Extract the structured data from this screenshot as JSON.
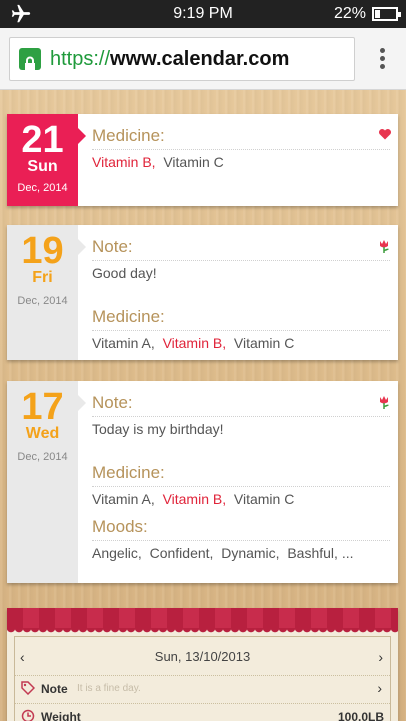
{
  "status": {
    "time": "9:19 PM",
    "battery": "22%",
    "battery_level": 0.22
  },
  "browser": {
    "url_scheme": "https://",
    "url_host": "www.calendar.com"
  },
  "entries": [
    {
      "day": "21",
      "weekday": "Sun",
      "month": "Dec, 2014",
      "sections": [
        {
          "title": "Medicine:",
          "items": [
            "Vitamin B,",
            "Vitamin C"
          ],
          "highlight": [
            true,
            false
          ]
        }
      ],
      "icon": "heart-icon"
    },
    {
      "day": "19",
      "weekday": "Fri",
      "month": "Dec, 2014",
      "sections": [
        {
          "title": "Note:",
          "text": "Good day!"
        },
        {
          "title": "Medicine:",
          "items": [
            "Vitamin A,",
            "Vitamin B,",
            "Vitamin C"
          ],
          "highlight": [
            false,
            true,
            false
          ]
        }
      ],
      "icon": "tulip-icon"
    },
    {
      "day": "17",
      "weekday": "Wed",
      "month": "Dec, 2014",
      "sections": [
        {
          "title": "Note:",
          "text": "Today is my birthday!"
        },
        {
          "title": "Medicine:",
          "items": [
            "Vitamin A,",
            "Vitamin B,",
            "Vitamin C"
          ],
          "highlight": [
            false,
            true,
            false
          ]
        },
        {
          "title": "Moods:",
          "items": [
            "Angelic,",
            "Confident,",
            "Dynamic,",
            "Bashful, ..."
          ],
          "highlight": [
            false,
            false,
            false,
            false
          ]
        }
      ],
      "icon": "tulip-icon"
    }
  ],
  "note_card": {
    "date": "Sun, 13/10/2013",
    "note_label": "Note",
    "note_placeholder": "It is a fine day.",
    "weight_label": "Weight",
    "weight_value": "100.0LB"
  },
  "colors": {
    "today": "#ea1f55",
    "other_day": "#f4a21a",
    "section_title": "#b6935b",
    "highlight": "#e0243a"
  }
}
